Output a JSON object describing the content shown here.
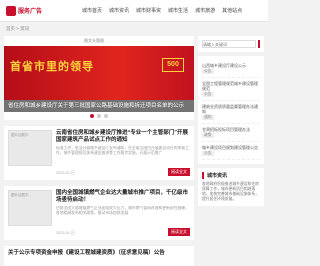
{
  "site": {
    "logo_text": "服务广告"
  },
  "nav": [
    "城市首页",
    "城市资讯",
    "城市财事资",
    "城市生活",
    "城市旅游",
    "其他站点"
  ],
  "breadcrumb": "首页 > 资讯",
  "banner": {
    "alt": "图文头版图",
    "headline": "首省市里的领导",
    "badge": "500",
    "caption": "省住房和城乡建设厅关于第三批国家公路基础设施和拆迁项目名单的公示"
  },
  "articles": [
    {
      "title": "云南省住房和城乡建设厅推进“专业一个主管部门”开展国家建筑产品试点工作的通知",
      "text": "标准工作，依法开展城乡建设厅发布通知，在全省范围内开展建设项目的申报工作，城乡管理规范体系建设推进等工作稳步实施，开展示范推广",
      "meta": "2023-01 日",
      "thumb": "图片加载中",
      "more": "阅读全文"
    },
    {
      "title": "国内全国城镇燃气企业达大量城市推广项目，千亿级市场亟待启动！",
      "text": "目前全国大量城镇燃气企业面临较大压力，城市燃气管网改造和更新迫在眉睫，各地相继发布相关政策，推动市场加快发展",
      "meta": "2023-01 日",
      "thumb": "图片加载中",
      "more": "阅读全文"
    },
    {
      "title": "关于公示专项资金申报《建设工程城建资质》（征求意见稿）公告",
      "text": "",
      "meta": "",
      "thumb": "",
      "more": ""
    }
  ],
  "sidebar": {
    "search_placeholder": "请输入关键词",
    "list": [
      {
        "text": "山西城乡建设厅建设公示",
        "tag": "公告"
      },
      {
        "text": "全国工程管理规范城乡建设管理规范",
        "tag": "公告"
      },
      {
        "text": "建筑业资质质量监督管理办法通知",
        "tag": "通知"
      },
      {
        "text": "甘肃招标投标项目管理办法",
        "tag": "政策"
      },
      {
        "text": "城乡建设项目规划建设管理公告",
        "tag": "公告"
      }
    ],
    "box_title": "城市资讯",
    "box_text": "各地政府积极推进城乡建设和住房保障工作，城市更新项目相继落地，加快完善城市基础设施体系，提升居住环境质量。"
  }
}
